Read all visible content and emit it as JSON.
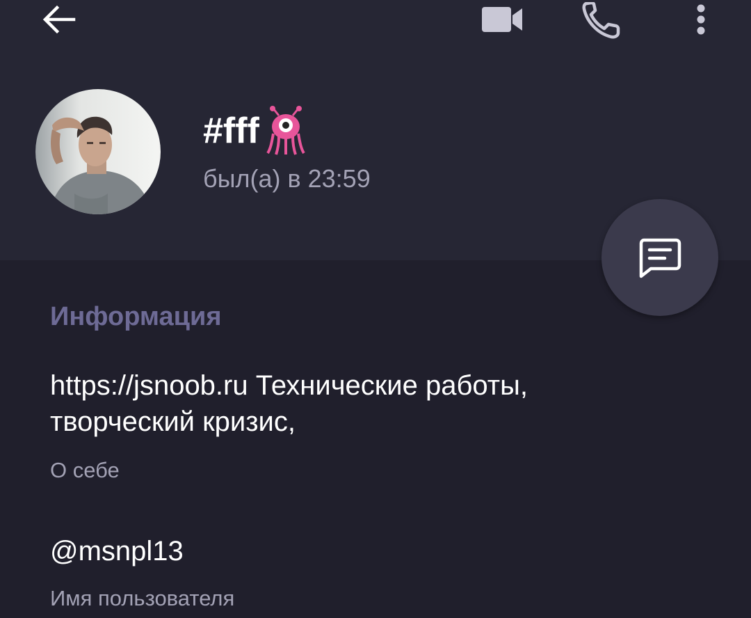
{
  "header": {
    "name": "#fff",
    "name_emoji": "alien-monster-emoji",
    "status": "был(а) в 23:59"
  },
  "icons": {
    "back": "arrow-left-icon",
    "video": "video-camera-icon",
    "call": "phone-icon",
    "more": "more-vertical-icon",
    "message": "message-icon"
  },
  "info": {
    "section_title": "Информация",
    "bio_line1": "https://jsnoob.ru Технические работы,",
    "bio_line2": "творческий кризис,",
    "bio_label": "О себе",
    "username": "@msnpl13",
    "username_label": "Имя пользователя"
  },
  "colors": {
    "header_bg": "#262634",
    "body_bg": "#201f2c",
    "accent": "#6e6b96",
    "secondary_text": "#a3a2b5",
    "fab_bg": "#3b3a4c"
  }
}
